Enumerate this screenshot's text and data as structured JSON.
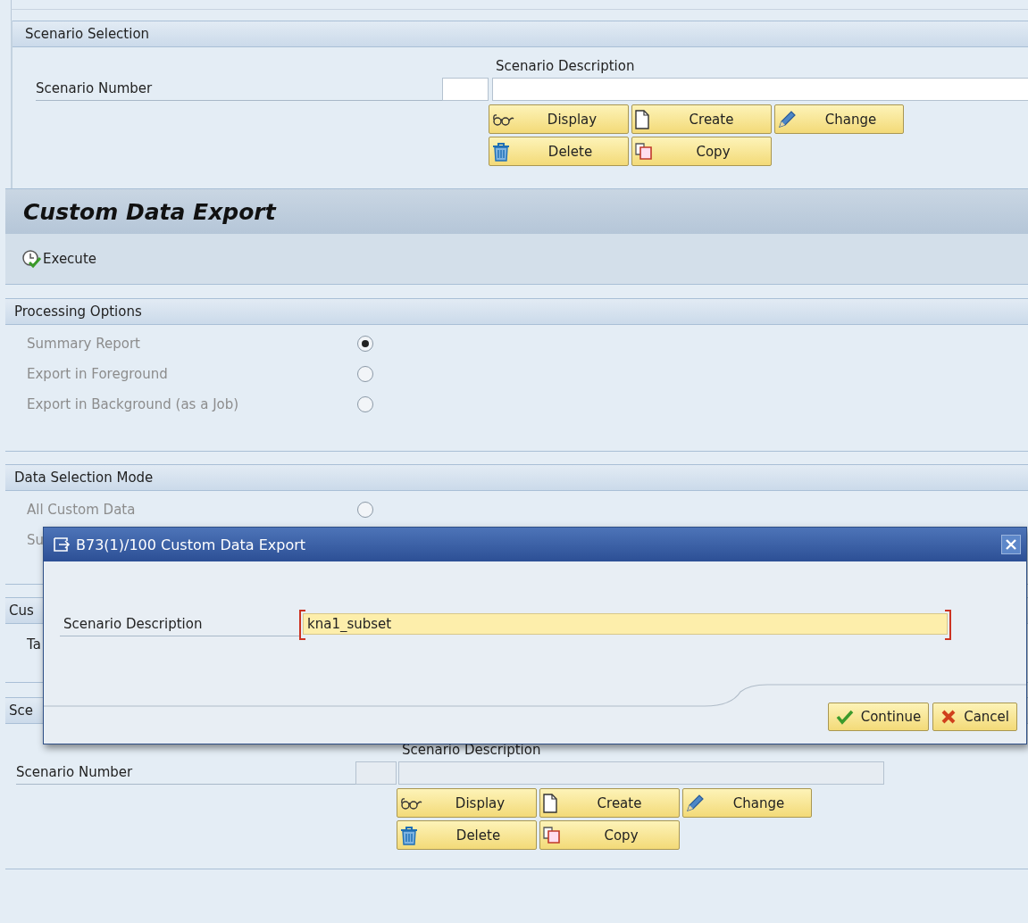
{
  "scenario_selection": {
    "title": "Scenario Selection",
    "description_heading": "Scenario Description",
    "number_label": "Scenario Number",
    "inputs_disabled": false,
    "buttons": [
      {
        "kind": "display",
        "label": "Display"
      },
      {
        "kind": "create",
        "label": "Create"
      },
      {
        "kind": "change",
        "label": "Change"
      },
      {
        "kind": "delete",
        "label": "Delete"
      },
      {
        "kind": "copy",
        "label": "Copy"
      }
    ]
  },
  "screen_title": "Custom Data Export",
  "toolbar": [
    {
      "kind": "execute",
      "label": "Execute"
    }
  ],
  "processing_options": {
    "title": "Processing Options",
    "options": [
      {
        "label": "Summary Report",
        "selected": true
      },
      {
        "label": "Export in Foreground",
        "selected": false
      },
      {
        "label": "Export in Background (as a Job)",
        "selected": false
      }
    ]
  },
  "data_selection_mode": {
    "title": "Data Selection Mode",
    "options": [
      {
        "label": "All Custom Data",
        "selected": false
      },
      {
        "label": "Su"
      }
    ]
  },
  "custom_section": {
    "title": "Cus",
    "rows": [
      "Ta"
    ]
  },
  "scenario_section": {
    "title": "Sce",
    "description_heading": "Scenario Description",
    "number_label": "Scenario Number",
    "inputs_disabled": true,
    "buttons": [
      {
        "kind": "display",
        "label": "Display"
      },
      {
        "kind": "create",
        "label": "Create"
      },
      {
        "kind": "change",
        "label": "Change"
      },
      {
        "kind": "delete",
        "label": "Delete"
      },
      {
        "kind": "copy",
        "label": "Copy"
      }
    ]
  },
  "dialog": {
    "title": "B73(1)/100 Custom Data Export",
    "field_label": "Scenario Description",
    "field_value": "kna1_subset",
    "buttons": [
      {
        "kind": "continue",
        "label": "Continue"
      },
      {
        "kind": "cancel",
        "label": "Cancel"
      }
    ]
  }
}
